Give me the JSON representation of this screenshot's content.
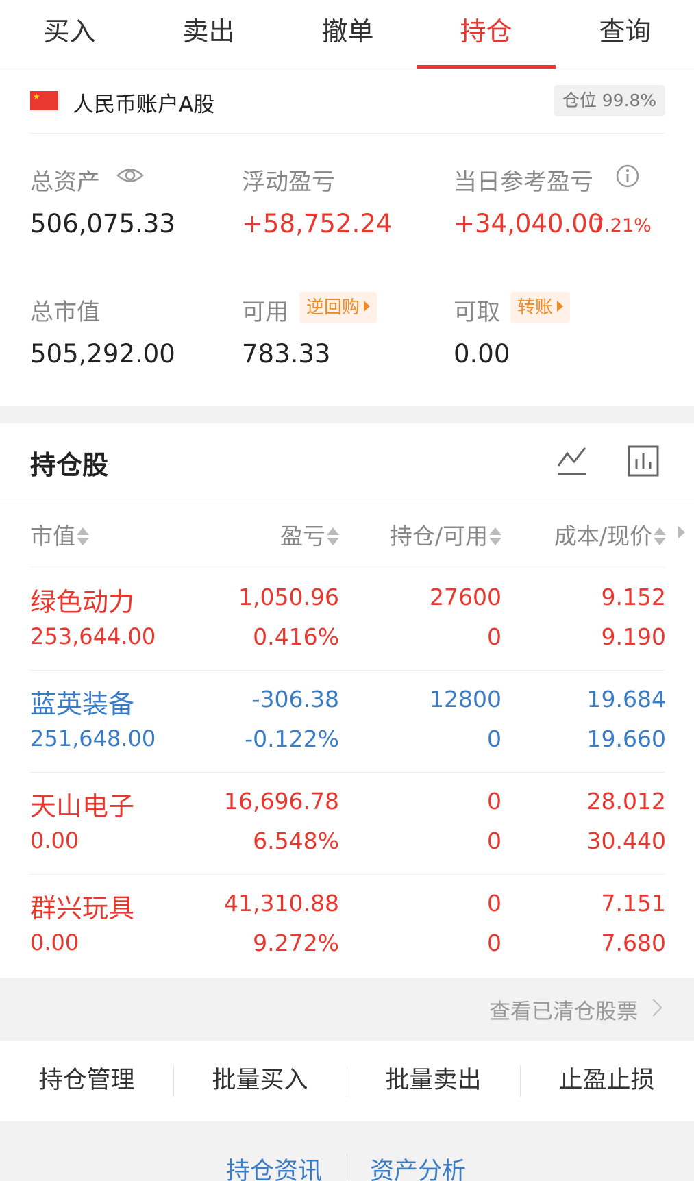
{
  "tabs": [
    {
      "label": "买入"
    },
    {
      "label": "卖出"
    },
    {
      "label": "撤单"
    },
    {
      "label": "持仓",
      "active": true
    },
    {
      "label": "查询"
    }
  ],
  "account": {
    "name": "人民币账户A股",
    "position_ratio": "仓位 99.8%",
    "flag_icon": "china-flag-icon"
  },
  "summary": {
    "total_assets_label": "总资产",
    "total_assets": "506,075.33",
    "floating_pl_label": "浮动盈亏",
    "floating_pl": "+58,752.24",
    "daily_pl_label": "当日参考盈亏",
    "daily_pl": "+34,040.00",
    "daily_pl_pct": "7.21%",
    "market_value_label": "总市值",
    "market_value": "505,292.00",
    "available_label": "可用",
    "available": "783.33",
    "reverse_repo_label": "逆回购",
    "withdrawable_label": "可取",
    "withdrawable": "0.00",
    "transfer_label": "转账"
  },
  "holdings": {
    "title": "持仓股",
    "columns": [
      "市值",
      "盈亏",
      "持仓/可用",
      "成本/现价"
    ],
    "rows": [
      {
        "name": "绿色动力",
        "market_value": "253,644.00",
        "pl": "1,050.96",
        "pl_pct": "0.416%",
        "position": "27600",
        "available": "0",
        "cost": "9.152",
        "price": "9.190",
        "color": "red"
      },
      {
        "name": "蓝英装备",
        "market_value": "251,648.00",
        "pl": "-306.38",
        "pl_pct": "-0.122%",
        "position": "12800",
        "available": "0",
        "cost": "19.684",
        "price": "19.660",
        "color": "blue"
      },
      {
        "name": "天山电子",
        "market_value": "0.00",
        "pl": "16,696.78",
        "pl_pct": "6.548%",
        "position": "0",
        "available": "0",
        "cost": "28.012",
        "price": "30.440",
        "color": "red"
      },
      {
        "name": "群兴玩具",
        "market_value": "0.00",
        "pl": "41,310.88",
        "pl_pct": "9.272%",
        "position": "0",
        "available": "0",
        "cost": "7.151",
        "price": "7.680",
        "color": "red"
      }
    ],
    "cleared_link": "查看已清仓股票"
  },
  "actions": [
    "持仓管理",
    "批量买入",
    "批量卖出",
    "止盈止损"
  ],
  "bottom_links": [
    "持仓资讯",
    "资产分析"
  ],
  "colors": {
    "up": "#e8382f",
    "down": "#3b7dc4",
    "accent": "#e8382f",
    "chip": "#f08a24"
  }
}
